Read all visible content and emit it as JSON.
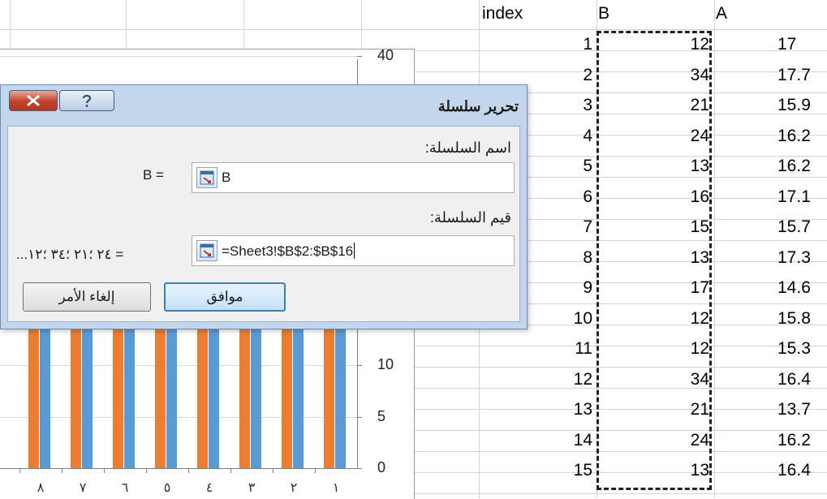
{
  "sheet": {
    "headers": {
      "index": "index",
      "b": "B",
      "a": "A"
    },
    "rows": [
      {
        "index": "1",
        "b": "12",
        "a": "17"
      },
      {
        "index": "2",
        "b": "34",
        "a": "17.7"
      },
      {
        "index": "3",
        "b": "21",
        "a": "15.9"
      },
      {
        "index": "4",
        "b": "24",
        "a": "16.2"
      },
      {
        "index": "5",
        "b": "13",
        "a": "16.2"
      },
      {
        "index": "6",
        "b": "16",
        "a": "17.1"
      },
      {
        "index": "7",
        "b": "15",
        "a": "15.7"
      },
      {
        "index": "8",
        "b": "13",
        "a": "17.3"
      },
      {
        "index": "9",
        "b": "17",
        "a": "14.6"
      },
      {
        "index": "10",
        "b": "12",
        "a": "15.8"
      },
      {
        "index": "11",
        "b": "12",
        "a": "15.3"
      },
      {
        "index": "12",
        "b": "34",
        "a": "16.4"
      },
      {
        "index": "13",
        "b": "21",
        "a": "13.7"
      },
      {
        "index": "14",
        "b": "24",
        "a": "16.2"
      },
      {
        "index": "15",
        "b": "13",
        "a": "16.4"
      }
    ]
  },
  "chart": {
    "y_ticks": [
      "0",
      "5",
      "10",
      "40"
    ],
    "x_categories": [
      "١",
      "٢",
      "٣",
      "٤",
      "٥",
      "٦",
      "٧",
      "٨"
    ],
    "colors": {
      "series_orange": "#ed7d31",
      "series_blue": "#5b9bd5"
    }
  },
  "dialog": {
    "title": "تحرير سلسلة",
    "series_name_label": "اسم السلسلة:",
    "series_name_equals": "B =",
    "series_name_value": "B",
    "series_values_label": "قيم السلسلة:",
    "series_values_equals": "...٢٤ ؛٢١ ؛٣٤ ؛١٢ =",
    "series_values_value": "=Sheet3!$B$2:$B$16",
    "ok_label": "موافق",
    "cancel_label": "إلغاء الأمر",
    "icons": {
      "close": "close-icon",
      "help": "help-icon",
      "collapse": "collapse-dialog-icon"
    }
  }
}
